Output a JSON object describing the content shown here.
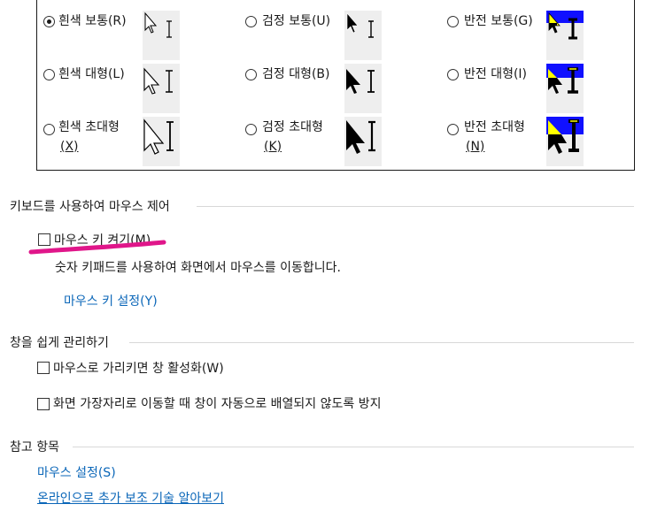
{
  "pointer_schemes": [
    {
      "label": "흰색 보통(R)",
      "selected": true,
      "style": "white",
      "size": "normal"
    },
    {
      "label": "검정 보통(U)",
      "selected": false,
      "style": "black",
      "size": "normal"
    },
    {
      "label": "반전 보통(G)",
      "selected": false,
      "style": "inverted",
      "size": "normal"
    },
    {
      "label": "흰색 대형(L)",
      "selected": false,
      "style": "white",
      "size": "large"
    },
    {
      "label": "검정 대형(B)",
      "selected": false,
      "style": "black",
      "size": "large"
    },
    {
      "label": "반전 대형(I)",
      "selected": false,
      "style": "inverted",
      "size": "large"
    },
    {
      "label_line1": "흰색 초대형",
      "label_line2": "(X)",
      "selected": false,
      "style": "white",
      "size": "xl"
    },
    {
      "label_line1": "검정 초대형",
      "label_line2": "(K)",
      "selected": false,
      "style": "black",
      "size": "xl"
    },
    {
      "label_line1": "반전 초대형",
      "label_line2": "(N)",
      "selected": false,
      "style": "inverted",
      "size": "xl"
    }
  ],
  "keyboard_section": {
    "title": "키보드를 사용하여 마우스 제어",
    "mousekeys_label": "마우스 키 켜기(M)",
    "mousekeys_checked": false,
    "description": "숫자 키패드를 사용하여 화면에서 마우스를 이동합니다.",
    "setup_link": "마우스 키 설정(Y)"
  },
  "windows_section": {
    "title": "창을 쉽게 관리하기",
    "hover_activate_label": "마우스로 가리키면 창 활성화(W)",
    "hover_activate_checked": false,
    "prevent_arrange_label": "화면 가장자리로 이동할 때 창이 자동으로 배열되지 않도록 방지",
    "prevent_arrange_checked": false
  },
  "see_also_section": {
    "title": "참고 항목",
    "mouse_settings_link": "마우스 설정(S)",
    "online_link": "온라인으로 추가 보조 기술 알아보기"
  },
  "colors": {
    "link": "#0a66b8",
    "highlight_mark": "#e0168a",
    "inverted_blue": "#1010ff",
    "inverted_yellow": "#ffff00"
  }
}
